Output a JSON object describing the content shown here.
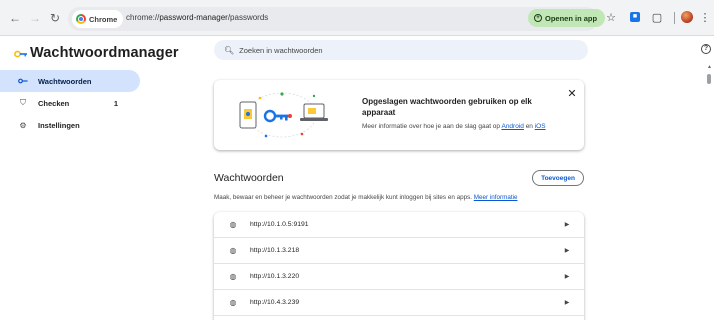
{
  "browser": {
    "chip_label": "Chrome",
    "url_scheme": "chrome://",
    "url_host": "password-manager",
    "url_path": "/passwords",
    "open_in_app_label": "Openen in app"
  },
  "header": {
    "title": "Wachtwoordmanager",
    "search_placeholder": "Zoeken in wachtwoorden"
  },
  "sidebar": {
    "items": [
      {
        "label": "Wachtwoorden",
        "icon": "key-icon",
        "active": true,
        "count": ""
      },
      {
        "label": "Checken",
        "icon": "checkup-icon",
        "active": false,
        "count": "1"
      },
      {
        "label": "Instellingen",
        "icon": "gear-icon",
        "active": false,
        "count": ""
      }
    ]
  },
  "promo": {
    "title": "Opgeslagen wachtwoorden gebruiken op elk apparaat",
    "body_prefix": "Meer informatie over hoe je aan de slag gaat op ",
    "link_android": "Android",
    "body_middle": " en ",
    "link_ios": "iOS"
  },
  "passwords": {
    "title": "Wachtwoorden",
    "add_label": "Toevoegen",
    "description": "Maak, bewaar en beheer je wachtwoorden zodat je makkelijk kunt inloggen bij sites en apps.",
    "learn_more": "Meer informatie",
    "items": [
      {
        "site": "http://10.1.0.5:9191"
      },
      {
        "site": "http://10.1.3.218"
      },
      {
        "site": "http://10.1.3.220"
      },
      {
        "site": "http://10.4.3.239"
      }
    ]
  },
  "colors": {
    "accent": "#0b57d0",
    "active_bg": "#d3e3fd",
    "open_in_app_bg": "#c2e7b6"
  }
}
